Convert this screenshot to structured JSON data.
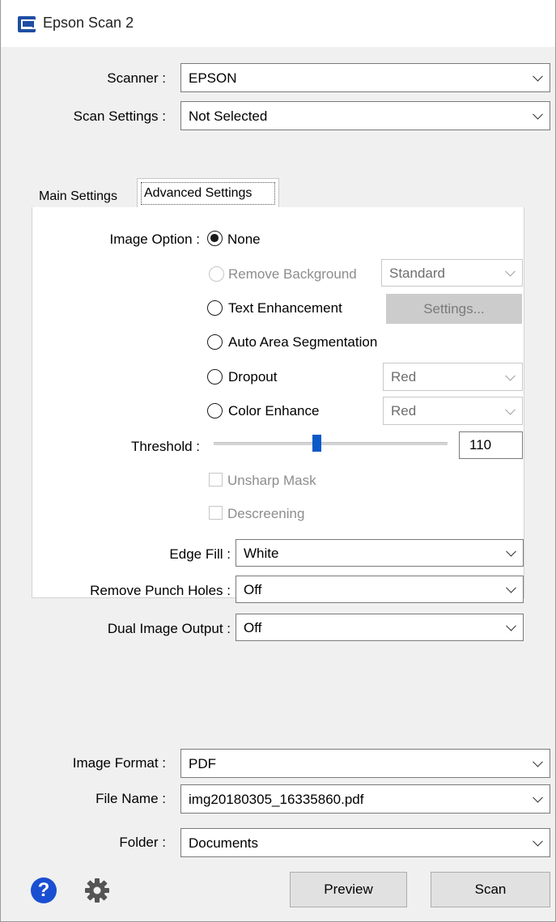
{
  "window": {
    "title": "Epson Scan 2"
  },
  "top": {
    "scanner": {
      "label": "Scanner :",
      "value": "EPSON"
    },
    "scan_settings": {
      "label": "Scan Settings :",
      "value": "Not Selected"
    }
  },
  "tabs": {
    "main": "Main Settings",
    "advanced": "Advanced Settings"
  },
  "advanced": {
    "image_option_label": "Image Option :",
    "options": {
      "none": "None",
      "remove_background": "Remove Background",
      "text_enhancement": "Text Enhancement",
      "auto_area": "Auto Area Segmentation",
      "dropout": "Dropout",
      "color_enhance": "Color Enhance"
    },
    "selected_option": "None",
    "remove_background_level": "Standard",
    "settings_button": "Settings...",
    "dropout_color": "Red",
    "color_enhance_color": "Red",
    "threshold": {
      "label": "Threshold :",
      "value": "110",
      "range": [
        0,
        255
      ]
    },
    "unsharp_mask": {
      "label": "Unsharp Mask",
      "checked": false
    },
    "descreening": {
      "label": "Descreening",
      "checked": false
    },
    "edge_fill": {
      "label": "Edge Fill :",
      "value": "White"
    },
    "remove_punch_holes": {
      "label": "Remove Punch Holes :",
      "value": "Off"
    },
    "dual_image_output": {
      "label": "Dual Image Output :",
      "value": "Off"
    }
  },
  "bottom": {
    "image_format": {
      "label": "Image Format :",
      "value": "PDF"
    },
    "file_name": {
      "label": "File Name :",
      "value": "img20180305_16335860.pdf"
    },
    "folder": {
      "label": "Folder :",
      "value": "Documents"
    },
    "preview_button": "Preview",
    "scan_button": "Scan",
    "help_glyph": "?"
  },
  "icons": {
    "app": "epson-scanner-icon",
    "help": "help-icon",
    "settings": "gear-icon",
    "dropdown": "chevron-down-icon"
  },
  "colors": {
    "accent": "#0a59c8",
    "help_blue": "#1a4fd2",
    "disabled_text": "#8d8d8d"
  }
}
